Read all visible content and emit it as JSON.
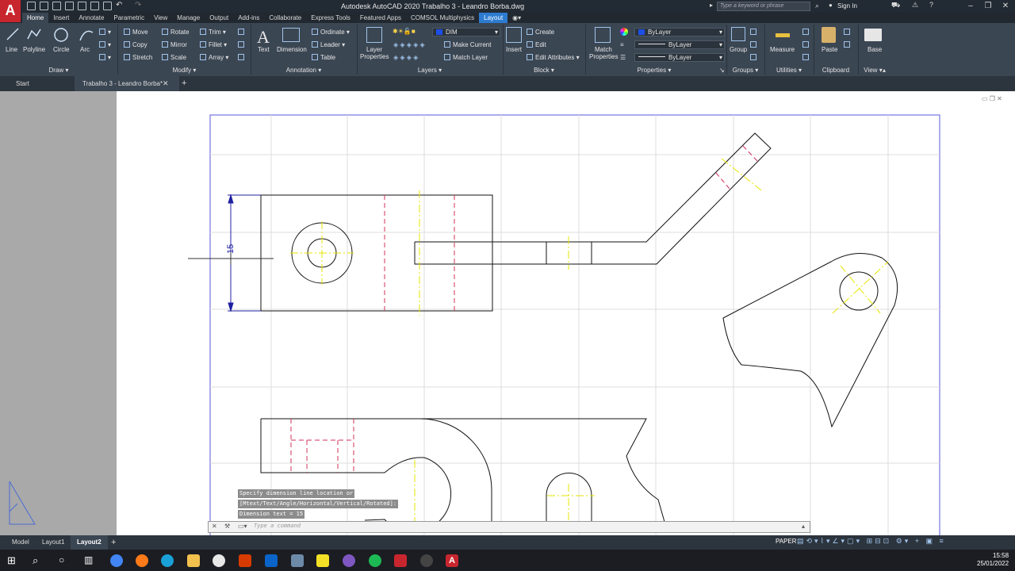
{
  "title_bar": {
    "app_logo": "A",
    "title": "Autodesk AutoCAD 2020    Trabalho 3 - Leandro Borba.dwg",
    "search_placeholder": "Type a keyword or phrase",
    "sign_in": "Sign In"
  },
  "ribbon_tabs": [
    "Home",
    "Insert",
    "Annotate",
    "Parametric",
    "View",
    "Manage",
    "Output",
    "Add-ins",
    "Collaborate",
    "Express Tools",
    "Featured Apps",
    "COMSOL Multiphysics",
    "Layout"
  ],
  "draw": {
    "line": "Line",
    "polyline": "Polyline",
    "circle": "Circle",
    "arc": "Arc",
    "title": "Draw"
  },
  "modify": {
    "move": "Move",
    "rotate": "Rotate",
    "trim": "Trim",
    "copy": "Copy",
    "mirror": "Mirror",
    "fillet": "Fillet",
    "stretch": "Stretch",
    "scale": "Scale",
    "array": "Array",
    "title": "Modify"
  },
  "annotation": {
    "text": "Text",
    "dimension": "Dimension",
    "ordinate": "Ordinate",
    "leader": "Leader",
    "table": "Table",
    "title": "Annotation"
  },
  "layers": {
    "properties": "Layer",
    "properties2": "Properties",
    "current_layer": "DIM",
    "make_current": "Make Current",
    "match_layer": "Match Layer",
    "title": "Layers"
  },
  "block": {
    "insert": "Insert",
    "create": "Create",
    "edit": "Edit",
    "edit_attributes": "Edit Attributes",
    "title": "Block"
  },
  "properties": {
    "match": "Match",
    "match2": "Properties",
    "color": "ByLayer",
    "linetype": "ByLayer",
    "lineweight": "ByLayer",
    "title": "Properties"
  },
  "groups": {
    "group": "Group",
    "title": "Groups"
  },
  "utilities": {
    "measure": "Measure",
    "title": "Utilities"
  },
  "clipboard": {
    "paste": "Paste",
    "title": "Clipboard"
  },
  "view": {
    "base": "Base",
    "title": "View"
  },
  "doc_tabs": {
    "start": "Start",
    "active": "Trabalho 3 - Leandro Borba*"
  },
  "drawing": {
    "dimension_value": "15"
  },
  "command": {
    "history": [
      "Specify dimension line location or",
      "[Mtext/Text/Angle/Horizontal/Vertical/Rotated]:",
      "Dimension text = 15"
    ],
    "placeholder": "Type a command"
  },
  "layout_tabs": [
    "Model",
    "Layout1",
    "Layout2"
  ],
  "status": {
    "paper": "PAPER"
  },
  "clock": {
    "time": "15:58",
    "date": "25/01/2022"
  },
  "colors": {
    "accent": "#2c7bd1",
    "dimension": "#2020a0",
    "hidden_line": "#d0305a",
    "center_line": "#e6e600",
    "logo": "#c8262e"
  }
}
